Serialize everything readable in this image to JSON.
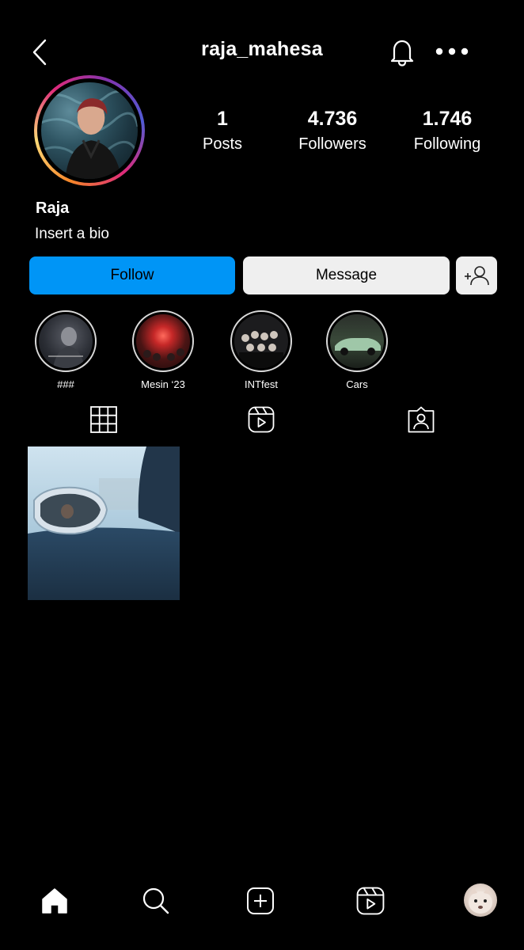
{
  "header": {
    "username": "raja_mahesa",
    "back_icon": "chevron-left-icon",
    "notification_icon": "bell-icon",
    "more_icon": "more-horizontal-icon"
  },
  "profile": {
    "display_name": "Raja",
    "bio": "Insert a bio",
    "stats": [
      {
        "value": "1",
        "label": "Posts"
      },
      {
        "value": "4.736",
        "label": "Followers"
      },
      {
        "value": "1.746",
        "label": "Following"
      }
    ]
  },
  "actions": {
    "follow_label": "Follow",
    "message_label": "Message",
    "suggest_icon": "add-person-icon"
  },
  "highlights": [
    {
      "label": "###"
    },
    {
      "label": "Mesin ‘23"
    },
    {
      "label": "INTfest"
    },
    {
      "label": "Cars"
    }
  ],
  "tabs": [
    {
      "name": "posts",
      "icon": "grid-icon"
    },
    {
      "name": "reels",
      "icon": "reels-icon"
    },
    {
      "name": "tagged",
      "icon": "tagged-person-icon"
    }
  ],
  "posts": [
    {
      "description": "car side mirror photo"
    }
  ],
  "bottom_nav": [
    {
      "name": "home",
      "icon": "home-icon"
    },
    {
      "name": "search",
      "icon": "search-icon"
    },
    {
      "name": "create",
      "icon": "plus-square-icon"
    },
    {
      "name": "reels",
      "icon": "reels-icon"
    },
    {
      "name": "profile",
      "icon": "avatar"
    }
  ],
  "colors": {
    "background": "#000000",
    "follow_button": "#0095f6",
    "message_button": "#efefef"
  }
}
